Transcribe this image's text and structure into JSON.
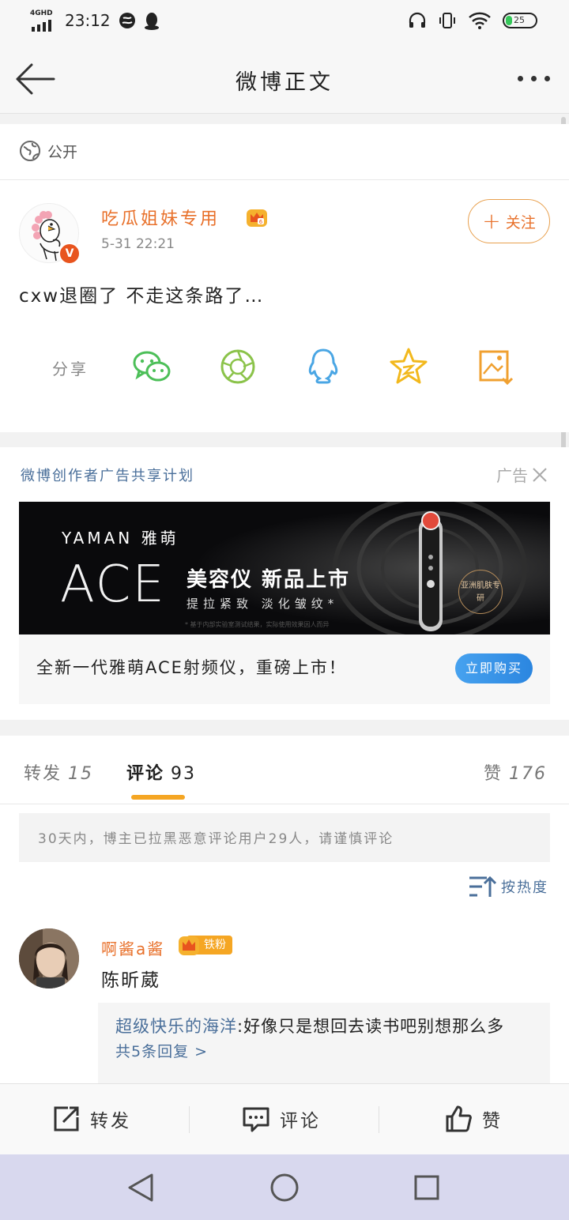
{
  "status_bar": {
    "network": "4GHD",
    "time": "23:12",
    "battery": "25"
  },
  "nav": {
    "title": "微博正文"
  },
  "post": {
    "visibility": "公开",
    "author": "吃瓜姐妹专用",
    "time": "5-31 22:21",
    "verified_badge": "V",
    "text": "cxw退圈了 不走这条路了…",
    "follow_label": "关注",
    "share_label": "分享",
    "share_targets": [
      "wechat-icon",
      "moments-icon",
      "qq-icon",
      "qzone-icon",
      "save-image-icon"
    ]
  },
  "ad": {
    "program": "微博创作者广告共享计划",
    "tag": "广告",
    "brand": "YAMAN 雅萌",
    "product": "ACE",
    "headline": "美容仪 新品上市",
    "subline": "提拉紧致 淡化皱纹*",
    "fine_print": "* 基于内部实验室测试结果，实际使用效果因人而异",
    "seal": "亚洲肌肤专研",
    "caption": "全新一代雅萌ACE射频仪，重磅上市！",
    "cta": "立即购买"
  },
  "tabs": [
    {
      "label": "转发",
      "count": "15"
    },
    {
      "label": "评论",
      "count": "93"
    },
    {
      "label": "赞",
      "count": "176"
    }
  ],
  "comments": {
    "notice": "30天内，博主已拉黑恶意评论用户29人，请谨慎评论",
    "sort_label": "按热度",
    "items": [
      {
        "user": "啊酱a酱",
        "badge": "铁粉",
        "text": "陈昕葳",
        "reply_user": "超级快乐的海洋",
        "reply_text": ":好像只是想回去读书吧别想那么多",
        "reply_more": "共5条回复 >"
      }
    ]
  },
  "action_bar": {
    "repost": "转发",
    "comment": "评论",
    "like": "赞"
  },
  "colors": {
    "accent": "#e8702a",
    "link": "#4a6f9a",
    "tab_indicator": "#f5a623",
    "cta": "#2b86e0"
  }
}
